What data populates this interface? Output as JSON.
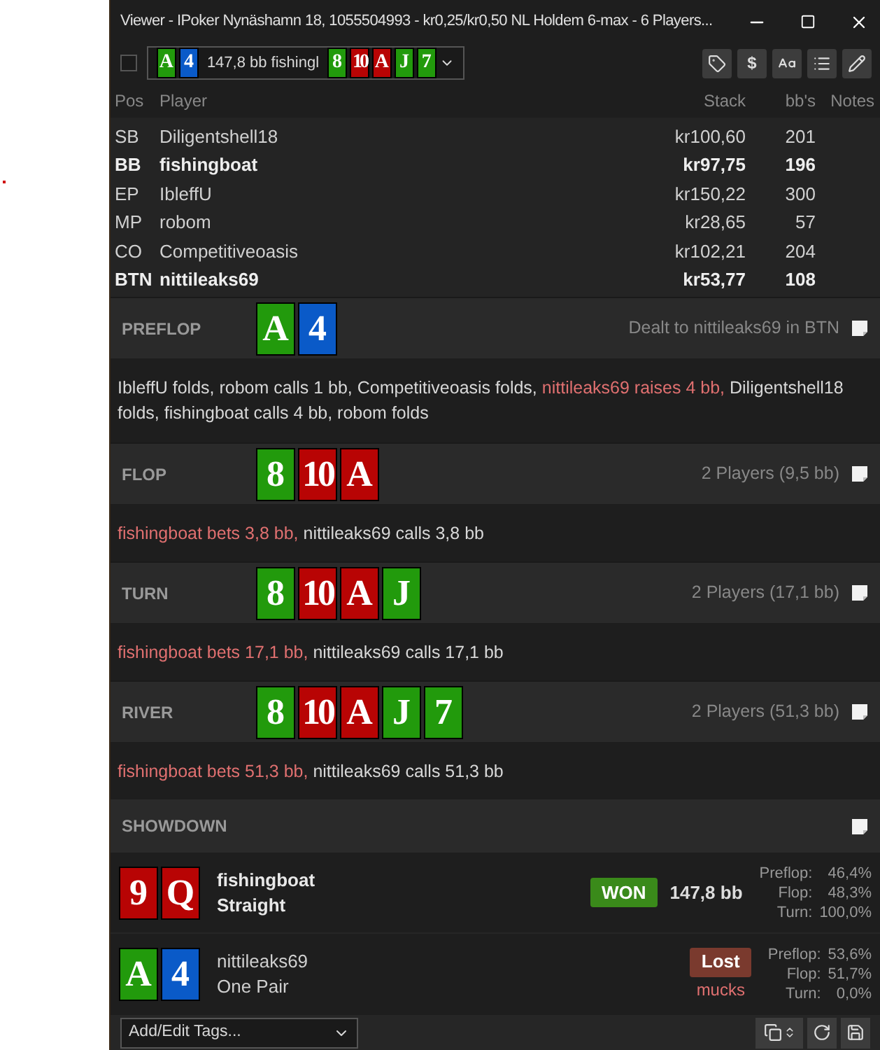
{
  "window": {
    "title": "Viewer - IPoker Nynäshamn 18, 1055504993 -  kr0,25/kr0,50 NL Holdem 6-max  - 6 Players..."
  },
  "toolbar": {
    "select_all_checked": false,
    "hand_selector": {
      "hole_cards": [
        {
          "rank": "A",
          "color": "#229a0c"
        },
        {
          "rank": "4",
          "color": "#0a5ac8"
        }
      ],
      "summary": "147,8 bb fishingl",
      "board": [
        {
          "rank": "8",
          "color": "#229a0c"
        },
        {
          "rank": "10",
          "color": "#b80404"
        },
        {
          "rank": "A",
          "color": "#b80404"
        },
        {
          "rank": "J",
          "color": "#229a0c"
        },
        {
          "rank": "7",
          "color": "#229a0c"
        }
      ]
    },
    "buttons": [
      {
        "kind": "tag"
      },
      {
        "kind": "currency",
        "label": "$"
      },
      {
        "kind": "font"
      },
      {
        "kind": "list"
      },
      {
        "kind": "edit"
      }
    ]
  },
  "players_table": {
    "columns": [
      "Pos",
      "Player",
      "Stack",
      "bb's",
      "Notes"
    ],
    "rows": [
      {
        "pos": "SB",
        "player": "Diligentshell18",
        "stack": "kr100,60",
        "bbs": "201",
        "highlighted": false
      },
      {
        "pos": "BB",
        "player": "fishingboat",
        "stack": "kr97,75",
        "bbs": "196",
        "highlighted": true
      },
      {
        "pos": "EP",
        "player": "IbleffU",
        "stack": "kr150,22",
        "bbs": "300",
        "highlighted": false
      },
      {
        "pos": "MP",
        "player": "robom",
        "stack": "kr28,65",
        "bbs": "57",
        "highlighted": false
      },
      {
        "pos": "CO",
        "player": "Competitiveoasis",
        "stack": "kr102,21",
        "bbs": "204",
        "highlighted": false
      },
      {
        "pos": "BTN",
        "player": "nittileaks69",
        "stack": "kr53,77",
        "bbs": "108",
        "highlighted": true
      }
    ]
  },
  "streets": [
    {
      "name": "PREFLOP",
      "cards": [
        {
          "rank": "A",
          "color": "#229a0c"
        },
        {
          "rank": "4",
          "color": "#0a5ac8"
        }
      ],
      "info": "Dealt to nittileaks69 in BTN",
      "actions": [
        {
          "text": "IbleffU folds, robom calls 1 bb, Competitiveoasis folds, ",
          "aggressive": false
        },
        {
          "text": "nittileaks69 raises 4 bb,",
          "aggressive": true
        },
        {
          "text": " Diligentshell18 folds, fishingboat calls 4 bb, robom folds",
          "aggressive": false
        }
      ]
    },
    {
      "name": "FLOP",
      "cards": [
        {
          "rank": "8",
          "color": "#229a0c"
        },
        {
          "rank": "10",
          "color": "#b80404"
        },
        {
          "rank": "A",
          "color": "#b80404"
        }
      ],
      "info": "2 Players (9,5 bb)",
      "actions": [
        {
          "text": "fishingboat bets 3,8 bb,",
          "aggressive": true
        },
        {
          "text": " nittileaks69 calls 3,8 bb",
          "aggressive": false
        }
      ]
    },
    {
      "name": "TURN",
      "cards": [
        {
          "rank": "8",
          "color": "#229a0c"
        },
        {
          "rank": "10",
          "color": "#b80404"
        },
        {
          "rank": "A",
          "color": "#b80404"
        },
        {
          "rank": "J",
          "color": "#229a0c"
        }
      ],
      "info": "2 Players (17,1 bb)",
      "actions": [
        {
          "text": "fishingboat bets 17,1 bb,",
          "aggressive": true
        },
        {
          "text": " nittileaks69 calls 17,1 bb",
          "aggressive": false
        }
      ]
    },
    {
      "name": "RIVER",
      "cards": [
        {
          "rank": "8",
          "color": "#229a0c"
        },
        {
          "rank": "10",
          "color": "#b80404"
        },
        {
          "rank": "A",
          "color": "#b80404"
        },
        {
          "rank": "J",
          "color": "#229a0c"
        },
        {
          "rank": "7",
          "color": "#229a0c"
        }
      ],
      "info": "2 Players (51,3 bb)",
      "actions": [
        {
          "text": "fishingboat bets 51,3 bb,",
          "aggressive": true
        },
        {
          "text": " nittileaks69 calls 51,3 bb",
          "aggressive": false
        }
      ]
    }
  ],
  "showdown": {
    "title": "SHOWDOWN",
    "players": [
      {
        "cards": [
          {
            "rank": "9",
            "color": "#b80404"
          },
          {
            "rank": "Q",
            "color": "#b80404"
          }
        ],
        "name": "fishingboat",
        "hand": "Straight",
        "kind": "win",
        "result_label": "WON",
        "amount": "147,8 bb",
        "equity": [
          {
            "street": "Preflop:",
            "value": "46,4%"
          },
          {
            "street": "Flop:",
            "value": "48,3%"
          },
          {
            "street": "Turn:",
            "value": "100,0%"
          }
        ]
      },
      {
        "cards": [
          {
            "rank": "A",
            "color": "#229a0c"
          },
          {
            "rank": "4",
            "color": "#0a5ac8"
          }
        ],
        "name": "nittileaks69",
        "hand": "One Pair",
        "kind": "loss",
        "result_label": "Lost",
        "note": "mucks",
        "equity": [
          {
            "street": "Preflop:",
            "value": "53,6%"
          },
          {
            "street": "Flop:",
            "value": "51,7%"
          },
          {
            "street": "Turn:",
            "value": "0,0%"
          }
        ]
      }
    ]
  },
  "footer": {
    "tags_dropdown": "Add/Edit Tags..."
  }
}
